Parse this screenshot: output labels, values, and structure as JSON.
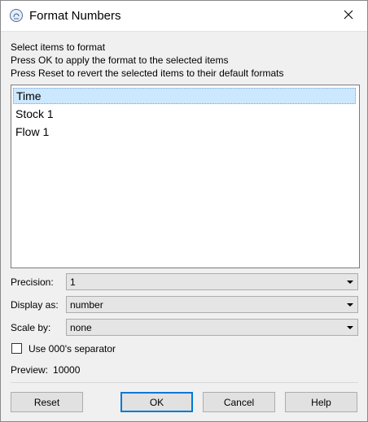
{
  "window": {
    "title": "Format Numbers",
    "app_icon": "app-icon",
    "close_icon": "close-icon"
  },
  "instructions": [
    "Select items to format",
    "Press OK to apply the format to the selected items",
    "Press Reset to revert the selected items to their default formats"
  ],
  "items": [
    {
      "label": "Time",
      "selected": true
    },
    {
      "label": "Stock 1",
      "selected": false
    },
    {
      "label": "Flow 1",
      "selected": false
    }
  ],
  "precision": {
    "label": "Precision:",
    "value": "1"
  },
  "display_as": {
    "label": "Display as:",
    "value": "number"
  },
  "scale_by": {
    "label": "Scale by:",
    "value": "none"
  },
  "separator_option": {
    "label": "Use 000's separator",
    "checked": false
  },
  "preview": {
    "label": "Preview:",
    "value": "10000"
  },
  "buttons": {
    "reset": "Reset",
    "ok": "OK",
    "cancel": "Cancel",
    "help": "Help"
  },
  "colors": {
    "selection": "#cce8ff",
    "default_button_border": "#0078d7"
  }
}
